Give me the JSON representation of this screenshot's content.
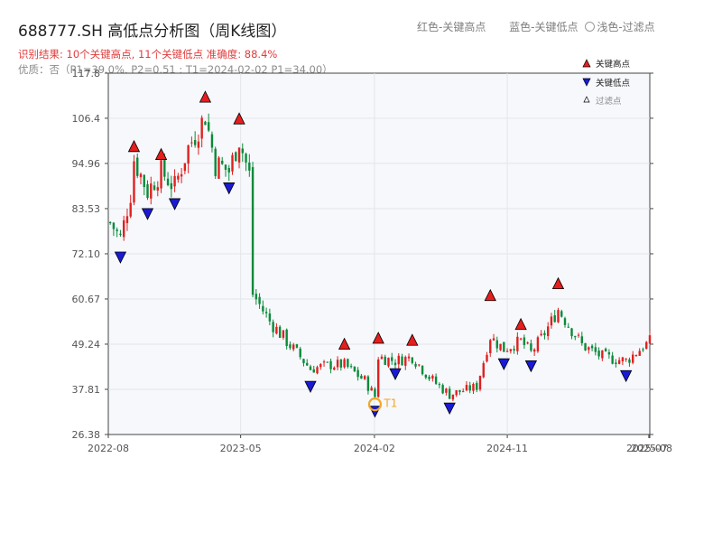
{
  "header": {
    "title": "688777.SH 高低点分析图（周K线图）",
    "result": "识别结果: 10个关键高点, 11个关键低点  准确度: 88.4%",
    "info": "优质：否（P1=39.0%, P2=0.51 ; T1=2024-02-02 P1=34.00）"
  },
  "top_legend": {
    "red": "红色-关键高点",
    "blue": "蓝色-关键低点",
    "faint": "浅色-过滤点"
  },
  "legend": {
    "high": "关键高点",
    "low": "关键低点",
    "filtered": "过滤点"
  },
  "colors": {
    "up": "#e02020",
    "down": "#0a8a3a",
    "high_marker": "#e61e1e",
    "low_marker": "#1a1ad6",
    "t1": "#f5a623",
    "plot_bg": "#f6f8fb",
    "grid": "#e3e6ea"
  },
  "chart_data": {
    "type": "candlestick",
    "title": "688777.SH 高低点分析图（周K线图）",
    "ylim": [
      26.38,
      117.8
    ],
    "y_ticks": [
      "26.38",
      "37.81",
      "49.24",
      "60.67",
      "72.10",
      "83.53",
      "94.96",
      "106.4",
      "117.8"
    ],
    "x_ticks": [
      "2022-08",
      "2023-05",
      "2024-02",
      "2024-11",
      "2025-07",
      "2025-08"
    ],
    "x_range": [
      "2022-08-01",
      "2025-08-22"
    ],
    "key_highs": [
      {
        "date": "2022-09-23",
        "price": 97.5
      },
      {
        "date": "2022-11-18",
        "price": 95.5
      },
      {
        "date": "2023-02-17",
        "price": 110.0
      },
      {
        "date": "2023-04-28",
        "price": 104.5
      },
      {
        "date": "2023-12-01",
        "price": 47.5
      },
      {
        "date": "2024-02-09",
        "price": 49.0
      },
      {
        "date": "2024-04-19",
        "price": 48.5
      },
      {
        "date": "2024-09-27",
        "price": 59.8
      },
      {
        "date": "2024-11-29",
        "price": 52.5
      },
      {
        "date": "2025-02-14",
        "price": 62.8
      }
    ],
    "key_lows": [
      {
        "date": "2022-08-26",
        "price": 73.0
      },
      {
        "date": "2022-10-21",
        "price": 84.0
      },
      {
        "date": "2022-12-16",
        "price": 86.5
      },
      {
        "date": "2023-04-07",
        "price": 90.5
      },
      {
        "date": "2023-09-22",
        "price": 40.3
      },
      {
        "date": "2024-02-02",
        "price": 34.0
      },
      {
        "date": "2024-03-15",
        "price": 43.5
      },
      {
        "date": "2024-07-05",
        "price": 34.8
      },
      {
        "date": "2024-10-25",
        "price": 46.0
      },
      {
        "date": "2024-12-20",
        "price": 45.5
      },
      {
        "date": "2025-07-04",
        "price": 43.0
      }
    ],
    "t1": {
      "label": "T1",
      "date": "2024-02-02",
      "price": 34.0
    },
    "weekly_close_anchors": [
      {
        "date": "2022-08-05",
        "price": 80.0
      },
      {
        "date": "2022-08-26",
        "price": 76.0
      },
      {
        "date": "2022-09-16",
        "price": 87.0
      },
      {
        "date": "2022-09-23",
        "price": 96.0
      },
      {
        "date": "2022-10-21",
        "price": 88.0
      },
      {
        "date": "2022-11-18",
        "price": 93.0
      },
      {
        "date": "2022-12-16",
        "price": 89.0
      },
      {
        "date": "2023-01-13",
        "price": 99.0
      },
      {
        "date": "2023-02-17",
        "price": 107.0
      },
      {
        "date": "2023-03-10",
        "price": 95.0
      },
      {
        "date": "2023-04-07",
        "price": 93.0
      },
      {
        "date": "2023-04-28",
        "price": 101.0
      },
      {
        "date": "2023-05-19",
        "price": 92.0
      },
      {
        "date": "2023-05-26",
        "price": 62.0
      },
      {
        "date": "2023-06-30",
        "price": 55.0
      },
      {
        "date": "2023-08-11",
        "price": 49.0
      },
      {
        "date": "2023-09-22",
        "price": 43.0
      },
      {
        "date": "2023-11-03",
        "price": 44.0
      },
      {
        "date": "2023-12-01",
        "price": 44.0
      },
      {
        "date": "2024-01-12",
        "price": 40.0
      },
      {
        "date": "2024-02-02",
        "price": 36.0
      },
      {
        "date": "2024-02-09",
        "price": 46.0
      },
      {
        "date": "2024-03-15",
        "price": 45.0
      },
      {
        "date": "2024-04-19",
        "price": 46.0
      },
      {
        "date": "2024-05-31",
        "price": 40.0
      },
      {
        "date": "2024-07-05",
        "price": 36.5
      },
      {
        "date": "2024-08-30",
        "price": 38.5
      },
      {
        "date": "2024-09-27",
        "price": 51.0
      },
      {
        "date": "2024-10-25",
        "price": 48.0
      },
      {
        "date": "2024-11-29",
        "price": 50.0
      },
      {
        "date": "2024-12-20",
        "price": 47.0
      },
      {
        "date": "2025-01-17",
        "price": 52.0
      },
      {
        "date": "2025-02-14",
        "price": 58.0
      },
      {
        "date": "2025-03-14",
        "price": 53.0
      },
      {
        "date": "2025-04-04",
        "price": 49.0
      },
      {
        "date": "2025-05-16",
        "price": 46.0
      },
      {
        "date": "2025-07-04",
        "price": 45.0
      },
      {
        "date": "2025-08-22",
        "price": 50.0
      }
    ]
  }
}
